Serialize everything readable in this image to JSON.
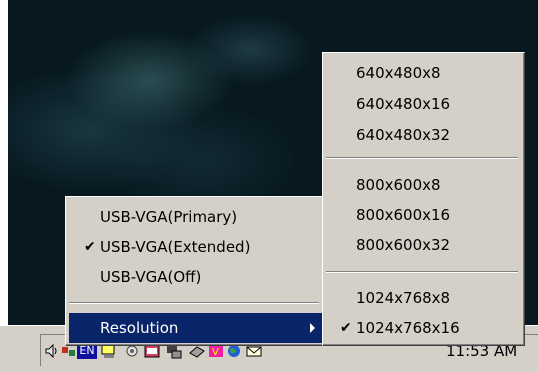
{
  "main_menu": {
    "items": [
      {
        "label": "USB-VGA(Primary)",
        "checked": false
      },
      {
        "label": "USB-VGA(Extended)",
        "checked": true
      },
      {
        "label": "USB-VGA(Off)",
        "checked": false
      }
    ],
    "resolution_label": "Resolution",
    "check_glyph": "✔"
  },
  "resolution_menu": {
    "items": [
      {
        "label": "640x480x8",
        "checked": false
      },
      {
        "label": "640x480x16",
        "checked": false
      },
      {
        "label": "640x480x32",
        "checked": false
      },
      {
        "label": "800x600x8",
        "checked": false
      },
      {
        "label": "800x600x16",
        "checked": false
      },
      {
        "label": "800x600x32",
        "checked": false
      },
      {
        "label": "1024x768x8",
        "checked": false
      },
      {
        "label": "1024x768x16",
        "checked": true
      }
    ]
  },
  "tray": {
    "language": "EN",
    "clock": "11:53 AM",
    "icons": [
      "speaker-icon",
      "network-icon",
      "language-icon",
      "display-icon",
      "settings-icon",
      "app-icon",
      "monitor-icon",
      "device-icon",
      "usb-vga-icon",
      "globe-icon",
      "mail-icon"
    ]
  },
  "colors": {
    "menu_bg": "#d4d0c8",
    "highlight": "#0a246a",
    "desktop": "#071820"
  }
}
